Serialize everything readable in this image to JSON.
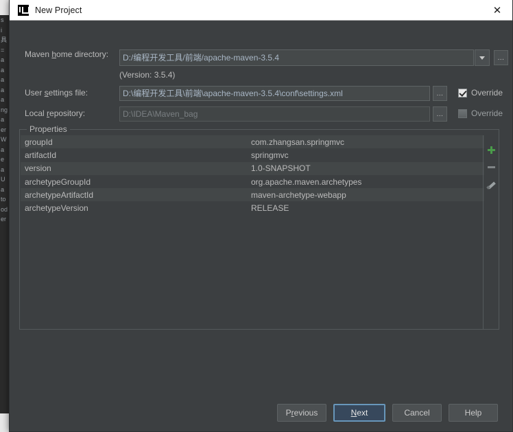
{
  "background": {
    "editor_fragments": [
      "s",
      "i",
      "具",
      "=",
      "a",
      "a",
      "a",
      "a",
      "a",
      "ng",
      "a",
      "er",
      "W",
      "a",
      "e",
      "a",
      "U",
      "a",
      "to",
      "od",
      "er"
    ]
  },
  "dialog": {
    "title": "New Project",
    "title_icon": "intellij-idea-logo-icon",
    "close_icon": "close-icon"
  },
  "form": {
    "maven_home": {
      "label_pre": "Maven ",
      "label_mnemonic": "h",
      "label_post": "ome directory:",
      "value": "D:/编程开发工具/前端/apache-maven-3.5.4",
      "dropdown_icon": "chevron-down-icon",
      "browse_label": "..."
    },
    "version_line": "(Version: 3.5.4)",
    "user_settings": {
      "label_pre": "User ",
      "label_mnemonic": "s",
      "label_post": "ettings file:",
      "value": "D:\\编程开发工具\\前端\\apache-maven-3.5.4\\conf\\settings.xml",
      "browse_label": "...",
      "override_label": "Override",
      "override_checked": true
    },
    "local_repository": {
      "label_pre": "Local ",
      "label_mnemonic": "r",
      "label_post": "epository:",
      "value": "D:\\IDEA\\Maven_bag",
      "browse_label": "...",
      "override_label": "Override",
      "override_checked": false
    }
  },
  "properties": {
    "legend": "Properties",
    "rows": [
      {
        "key": "groupId",
        "value": "com.zhangsan.springmvc"
      },
      {
        "key": "artifactId",
        "value": "springmvc"
      },
      {
        "key": "version",
        "value": "1.0-SNAPSHOT"
      },
      {
        "key": "archetypeGroupId",
        "value": "org.apache.maven.archetypes"
      },
      {
        "key": "archetypeArtifactId",
        "value": "maven-archetype-webapp"
      },
      {
        "key": "archetypeVersion",
        "value": "RELEASE"
      }
    ],
    "toolbar": {
      "add_icon": "plus-icon",
      "remove_icon": "minus-icon",
      "edit_icon": "pencil-icon"
    }
  },
  "footer": {
    "previous": {
      "pre": "P",
      "mnemonic": "r",
      "post": "evious"
    },
    "next": {
      "pre": "",
      "mnemonic": "N",
      "post": "ext"
    },
    "cancel": {
      "pre": "Cancel",
      "mnemonic": "",
      "post": ""
    },
    "help": {
      "pre": "Help",
      "mnemonic": "",
      "post": ""
    }
  },
  "colors": {
    "dialog_bg": "#3c3f41",
    "field_bg": "#45494a",
    "text": "#bbbbbb",
    "field_text": "#a9b7c6",
    "accent_focus": "#6897bb",
    "primary_btn": "#37485c",
    "add_green": "#4a9b4a"
  }
}
